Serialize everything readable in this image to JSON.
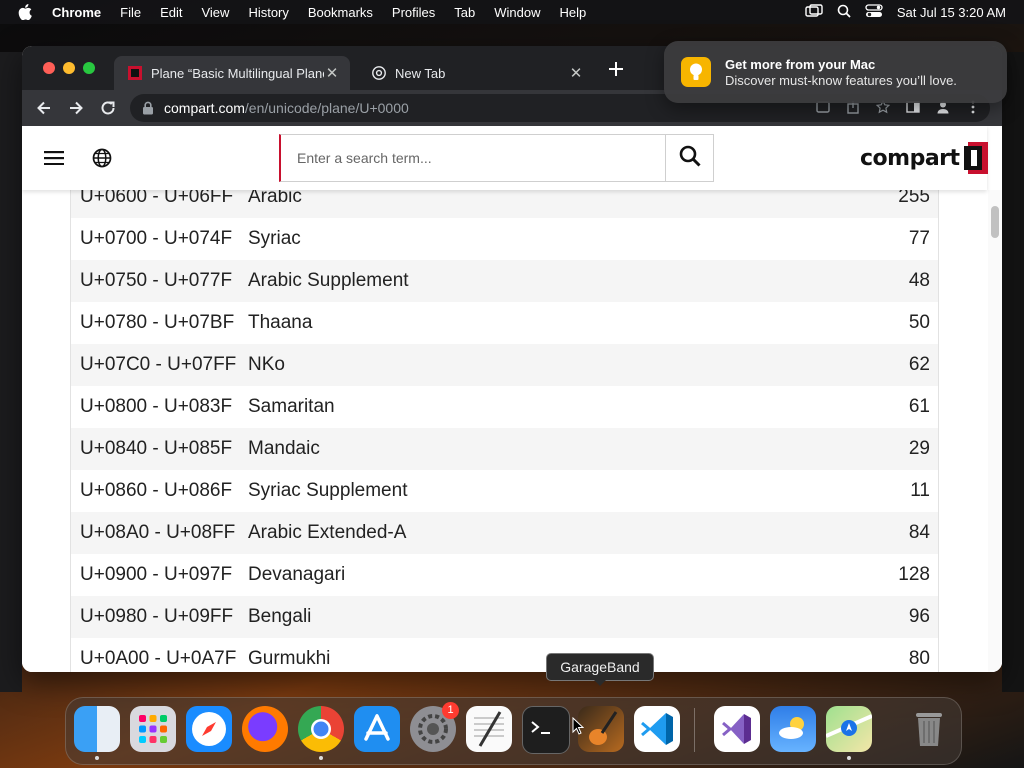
{
  "menubar": {
    "app": "Chrome",
    "items": [
      "File",
      "Edit",
      "View",
      "History",
      "Bookmarks",
      "Profiles",
      "Tab",
      "Window",
      "Help"
    ],
    "clock": "Sat Jul 15  3:20 AM"
  },
  "browser": {
    "tabs": [
      {
        "title": "Plane “Basic Multilingual Plane”",
        "active": true
      },
      {
        "title": "New Tab",
        "active": false
      }
    ],
    "url_host": "compart.com",
    "url_path": "/en/unicode/plane/U+0000"
  },
  "notification": {
    "title": "Get more from your Mac",
    "body": "Discover must-know features you’ll love."
  },
  "site": {
    "search_placeholder": "Enter a search term...",
    "logo_text": "compart"
  },
  "blocks": [
    {
      "range": "U+0600 - U+06FF",
      "name": "Arabic",
      "count": "255"
    },
    {
      "range": "U+0700 - U+074F",
      "name": "Syriac",
      "count": "77"
    },
    {
      "range": "U+0750 - U+077F",
      "name": "Arabic Supplement",
      "count": "48"
    },
    {
      "range": "U+0780 - U+07BF",
      "name": "Thaana",
      "count": "50"
    },
    {
      "range": "U+07C0 - U+07FF",
      "name": "NKo",
      "count": "62"
    },
    {
      "range": "U+0800 - U+083F",
      "name": "Samaritan",
      "count": "61"
    },
    {
      "range": "U+0840 - U+085F",
      "name": "Mandaic",
      "count": "29"
    },
    {
      "range": "U+0860 - U+086F",
      "name": "Syriac Supplement",
      "count": "11"
    },
    {
      "range": "U+08A0 - U+08FF",
      "name": "Arabic Extended-A",
      "count": "84"
    },
    {
      "range": "U+0900 - U+097F",
      "name": "Devanagari",
      "count": "128"
    },
    {
      "range": "U+0980 - U+09FF",
      "name": "Bengali",
      "count": "96"
    },
    {
      "range": "U+0A00 - U+0A7F",
      "name": "Gurmukhi",
      "count": "80"
    }
  ],
  "dock": {
    "tooltip": "GarageBand",
    "badge": "1",
    "apps": [
      "finder",
      "launchpad",
      "safari",
      "firefox",
      "chrome",
      "app-store",
      "system-settings",
      "textedit",
      "terminal",
      "garageband",
      "vscode",
      "visual-studio",
      "weather",
      "maps",
      "trash"
    ]
  },
  "colors": {
    "brand_red": "#c8102e",
    "row_alt": "#f5f5f5",
    "chrome_dark": "#202124"
  }
}
